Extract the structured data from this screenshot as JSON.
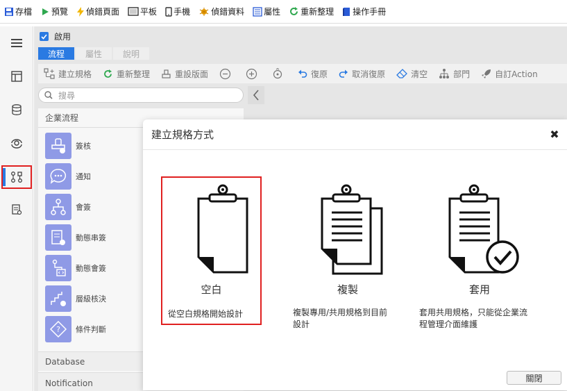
{
  "topbar": {
    "items": [
      {
        "label": "存檔",
        "icon": "save-icon"
      },
      {
        "label": "預覽",
        "icon": "play-icon"
      },
      {
        "label": "偵錯頁面",
        "icon": "lightning-icon"
      },
      {
        "label": "平板",
        "icon": "tablet-icon"
      },
      {
        "label": "手機",
        "icon": "phone-icon"
      },
      {
        "label": "偵錯資料",
        "icon": "bug-icon"
      },
      {
        "label": "屬性",
        "icon": "properties-icon"
      },
      {
        "label": "重新整理",
        "icon": "refresh-icon"
      },
      {
        "label": "操作手冊",
        "icon": "book-icon"
      }
    ]
  },
  "rail": {
    "items": [
      "menu-icon",
      "layout-icon",
      "database-icon",
      "eye-icon",
      "flow-icon",
      "report-icon"
    ],
    "active_index": 4
  },
  "main": {
    "enable_label": "啟用",
    "tabs": [
      "流程",
      "屬性",
      "說明"
    ],
    "toolbar": [
      {
        "label": "建立規格",
        "icon": "create-spec-icon"
      },
      {
        "label": "重新整理",
        "icon": "refresh-icon"
      },
      {
        "label": "重設版面",
        "icon": "reset-layout-icon"
      },
      {
        "label": "",
        "icon": "zoom-out-icon"
      },
      {
        "label": "",
        "icon": "zoom-in-icon"
      },
      {
        "label": "",
        "icon": "fit-icon"
      },
      {
        "label": "復原",
        "icon": "undo-icon"
      },
      {
        "label": "取消復原",
        "icon": "redo-icon"
      },
      {
        "label": "清空",
        "icon": "eraser-icon"
      },
      {
        "label": "部門",
        "icon": "org-icon"
      },
      {
        "label": "自訂Action",
        "icon": "rocket-icon"
      }
    ],
    "search_placeholder": "搜尋",
    "palette": {
      "header": "企業流程",
      "items": [
        "簽核",
        "通知",
        "會簽",
        "動態串簽",
        "動態會簽",
        "層級核決",
        "條件判斷"
      ],
      "sections": [
        "Database",
        "Notification"
      ]
    }
  },
  "modal": {
    "title": "建立規格方式",
    "options": [
      {
        "title": "空白",
        "desc": "從空白規格開始設計",
        "icon": "blank-clipboard-icon"
      },
      {
        "title": "複製",
        "desc": "複製專用/共用規格到目前設計",
        "icon": "copy-clipboard-icon"
      },
      {
        "title": "套用",
        "desc": "套用共用規格，只能從企業流程管理介面維護",
        "icon": "apply-clipboard-icon"
      }
    ],
    "desc_lines": [
      [
        "從空白規格開始設計"
      ],
      [
        "複製專用/共用規格到目前",
        "設計"
      ],
      [
        "套用共用規格，只能從企業流",
        "程管理介面維護"
      ]
    ],
    "close_label": "關閉",
    "selected_index": 0
  },
  "colors": {
    "accent": "#2a7ae2",
    "highlight": "#e02020",
    "palette_icon": "#8f9ae6"
  }
}
